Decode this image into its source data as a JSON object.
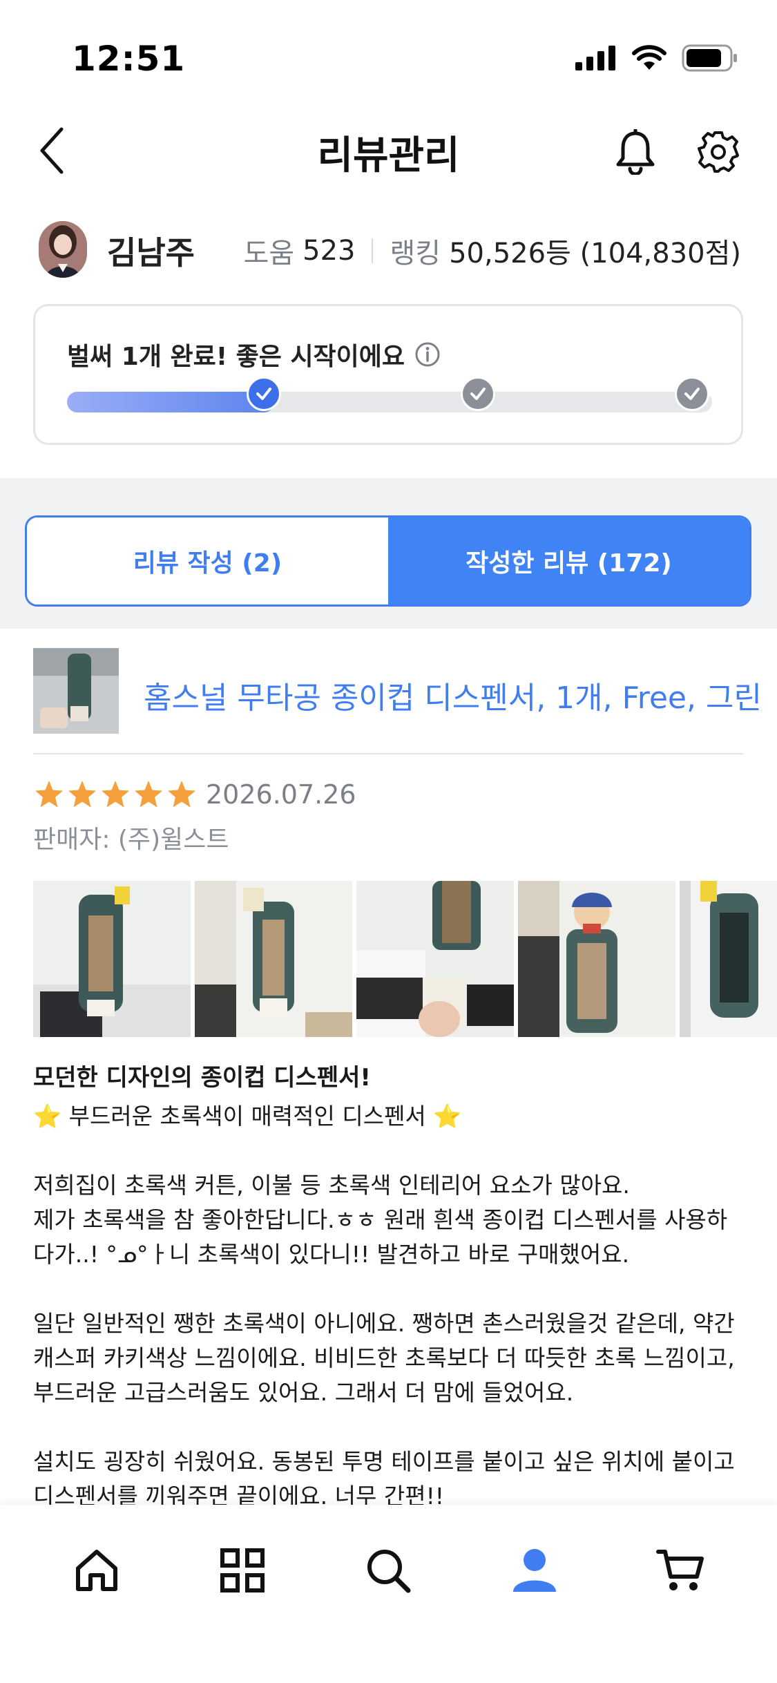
{
  "status_bar": {
    "time": "12:51"
  },
  "header": {
    "title": "리뷰관리"
  },
  "profile": {
    "name": "김남주",
    "help_label": "도움",
    "help_count": "523",
    "ranking_label": "랭킹",
    "ranking_value": "50,526등 (104,830점)"
  },
  "progress": {
    "message": "벌써 1개 완료! 좋은 시작이에요",
    "completed_steps": 1,
    "total_steps": 3
  },
  "tabs": [
    {
      "label": "리뷰 작성 (2)",
      "active": false
    },
    {
      "label": "작성한 리뷰 (172)",
      "active": true
    }
  ],
  "review": {
    "product_name": "홈스널 무타공 종이컵 디스펜서, 1개, Free, 그린",
    "rating": 5,
    "date": "2026.07.26",
    "seller": "판매자: (주)윌스트",
    "heading": "모던한 디자인의 종이컵 디스펜서!",
    "subheading": "⭐ 부드러운 초록색이 매력적인 디스펜서 ⭐",
    "lines": [
      "저희집이 초록색 커튼, 이불 등 초록색 인테리어 요소가 많아요.",
      "제가 초록색을 참 좋아한답니다.ㅎㅎ 원래 흰색 종이컵 디스펜서를 사용하",
      "다가..! °ᓄ°ㅏ니 초록색이 있다니!! 발견하고 바로 구매했어요.",
      "",
      "일단 일반적인 쨍한 초록색이 아니에요. 쨍하면 촌스러웠을것 같은데, 약간",
      "캐스퍼 카키색상 느낌이에요. 비비드한 초록보다 더 따듯한 초록 느낌이고,",
      "부드러운 고급스러움도 있어요. 그래서 더 맘에 들었어요.",
      "",
      "설치도 굉장히 쉬웠어요. 동봉된 투명 테이프를 붙이고 싶은 위치에 붙이고",
      "디스펜서를 끼워주면 끝이에요. 너무 간편!!"
    ]
  },
  "colors": {
    "accent": "#3f7df0",
    "star": "#f5a03a"
  },
  "nav": [
    "home-icon",
    "grid-icon",
    "search-icon",
    "person-icon",
    "cart-icon"
  ]
}
